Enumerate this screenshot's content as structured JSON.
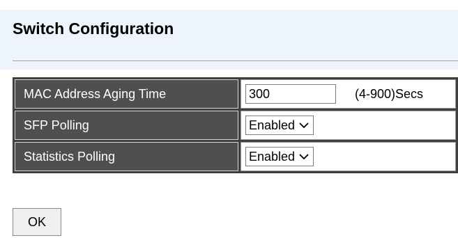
{
  "header": {
    "title": "Switch Configuration"
  },
  "rows": [
    {
      "label": "MAC Address Aging Time",
      "input_value": "300",
      "unit": "(4-900)Secs"
    },
    {
      "label": "SFP Polling",
      "selected": "Enabled"
    },
    {
      "label": "Statistics Polling",
      "selected": "Enabled"
    }
  ],
  "actions": {
    "ok_label": "OK"
  },
  "icons": {
    "dropdown": "chevron-down-icon"
  },
  "colors": {
    "title_band": "#eef4fb",
    "label_cell": "#4f4f4f",
    "table_frame": "#3f3f3f"
  }
}
